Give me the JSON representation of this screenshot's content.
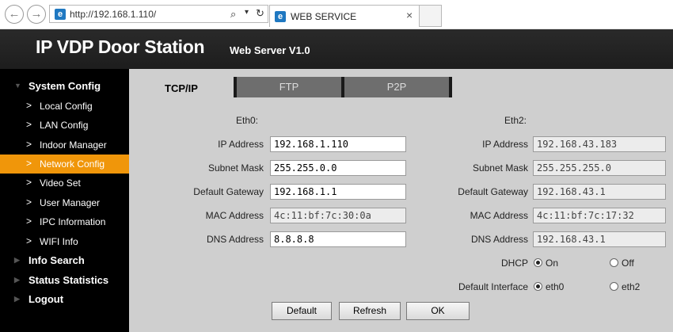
{
  "browser": {
    "url": "http://192.168.1.110/",
    "tab_title": "WEB SERVICE",
    "back_glyph": "←",
    "forward_glyph": "→"
  },
  "header": {
    "title": "IP VDP Door Station",
    "subtitle": "Web Server V1.0"
  },
  "sidebar": {
    "groups": [
      {
        "label": "System Config"
      },
      {
        "label": "Info Search"
      },
      {
        "label": "Status Statistics"
      },
      {
        "label": "Logout"
      }
    ],
    "items": [
      {
        "label": "Local Config"
      },
      {
        "label": "LAN Config"
      },
      {
        "label": "Indoor Manager"
      },
      {
        "label": "Network Config"
      },
      {
        "label": "Video Set"
      },
      {
        "label": "User Manager"
      },
      {
        "label": "IPC Information"
      },
      {
        "label": "WIFI Info"
      }
    ],
    "active_item": "Network Config",
    "active_color": "#f0960a"
  },
  "tabs": [
    {
      "label": "TCP/IP"
    },
    {
      "label": "FTP"
    },
    {
      "label": "P2P"
    }
  ],
  "form": {
    "eth0": {
      "heading": "Eth0:",
      "ip_label": "IP Address",
      "ip_value": "192.168.1.110",
      "mask_label": "Subnet Mask",
      "mask_value": "255.255.0.0",
      "gateway_label": "Default Gateway",
      "gateway_value": "192.168.1.1",
      "mac_label": "MAC Address",
      "mac_value": "4c:11:bf:7c:30:0a",
      "dns_label": "DNS Address",
      "dns_value": "8.8.8.8"
    },
    "eth2": {
      "heading": "Eth2:",
      "ip_label": "IP Address",
      "ip_value": "192.168.43.183",
      "mask_label": "Subnet Mask",
      "mask_value": "255.255.255.0",
      "gateway_label": "Default Gateway",
      "gateway_value": "192.168.43.1",
      "mac_label": "MAC Address",
      "mac_value": "4c:11:bf:7c:17:32",
      "dns_label": "DNS Address",
      "dns_value": "192.168.43.1"
    },
    "dhcp": {
      "label": "DHCP",
      "option_on": "On",
      "option_off": "Off",
      "selected": "On"
    },
    "default_interface": {
      "label": "Default Interface",
      "option_a": "eth0",
      "option_b": "eth2",
      "selected": "eth0"
    }
  },
  "buttons": {
    "default": "Default",
    "refresh": "Refresh",
    "ok": "OK"
  }
}
